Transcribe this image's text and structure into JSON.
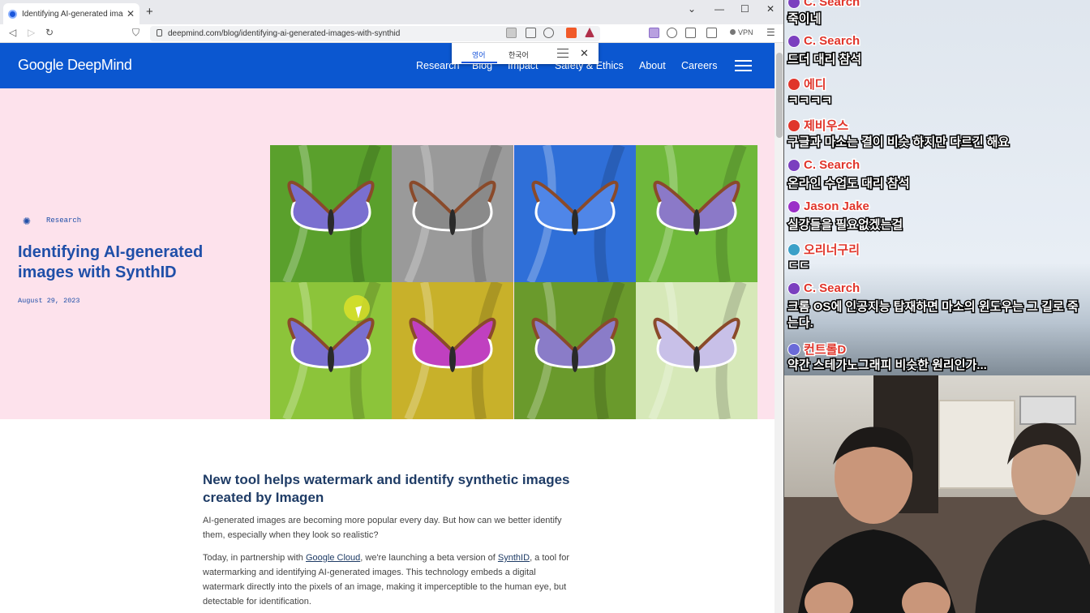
{
  "browser": {
    "tab_title": "Identifying AI-generated images",
    "url": "deepmind.com/blog/identifying-ai-generated-images-with-synthid",
    "vpn_label": "VPN"
  },
  "translate_popup": {
    "source_lang": "영어",
    "target_lang": "한국어"
  },
  "site": {
    "logo": "Google DeepMind",
    "nav": [
      "Research",
      "Blog",
      "Impact",
      "Safety & Ethics",
      "About",
      "Careers"
    ],
    "brand_color": "#0b57d0"
  },
  "hero": {
    "category": "Research",
    "title": "Identifying AI-generated images with SynthID",
    "date": "August 29, 2023",
    "background": "#fde2ec"
  },
  "article": {
    "heading": "New tool helps watermark and identify synthetic images created by Imagen",
    "p1": "AI-generated images are becoming more popular every day. But how can we better identify them, especially when they look so realistic?",
    "p2_a": "Today, in partnership with ",
    "p2_link1": "Google Cloud",
    "p2_b": ", we're launching a beta version of ",
    "p2_link2": "SynthID",
    "p2_c": ", a tool for watermarking and identifying AI-generated images. This technology embeds a digital watermark directly into the pixels of an image, making it imperceptible to the human eye, but detectable for identification."
  },
  "chat": [
    {
      "user": "C. Search",
      "message": "죽이네",
      "badge_color": "#7b3fbf"
    },
    {
      "user": "C. Search",
      "message": "드더 대리 참석",
      "badge_color": "#7b3fbf"
    },
    {
      "user": "에디",
      "message": "ㅋㅋㅋㅋ",
      "badge_color": "#e0352b"
    },
    {
      "user": "제비우스",
      "message": "구글과 마소는 결이 비슷 하지만 다르긴 해요",
      "badge_color": "#e0352b"
    },
    {
      "user": "C. Search",
      "message": "온라인 수업도 대리 참석",
      "badge_color": "#7b3fbf"
    },
    {
      "user": "Jason Jake",
      "message": "실강들을 필요없겠는걸",
      "badge_color": "#9b30c8"
    },
    {
      "user": "오리너구리",
      "message": "ㄷㄷ",
      "badge_color": "#3aa0c8"
    },
    {
      "user": "C. Search",
      "message": "크롬 OS에 인공지능 탑재하면 마소의 윈도우는 그 길로 죽는다.",
      "badge_color": "#7b3fbf"
    },
    {
      "user": "컨트롤D",
      "message": "약간 스테가노그래피 비슷한 원리인가...",
      "badge_color": "#6a6ad8"
    }
  ],
  "butterfly_tints": [
    "#5aa02c",
    "#9a9a9a",
    "#2f6fd8",
    "#6fb83a",
    "#8cc43a",
    "#c8b12a",
    "#6a9a2c",
    "#d6e8b8"
  ]
}
